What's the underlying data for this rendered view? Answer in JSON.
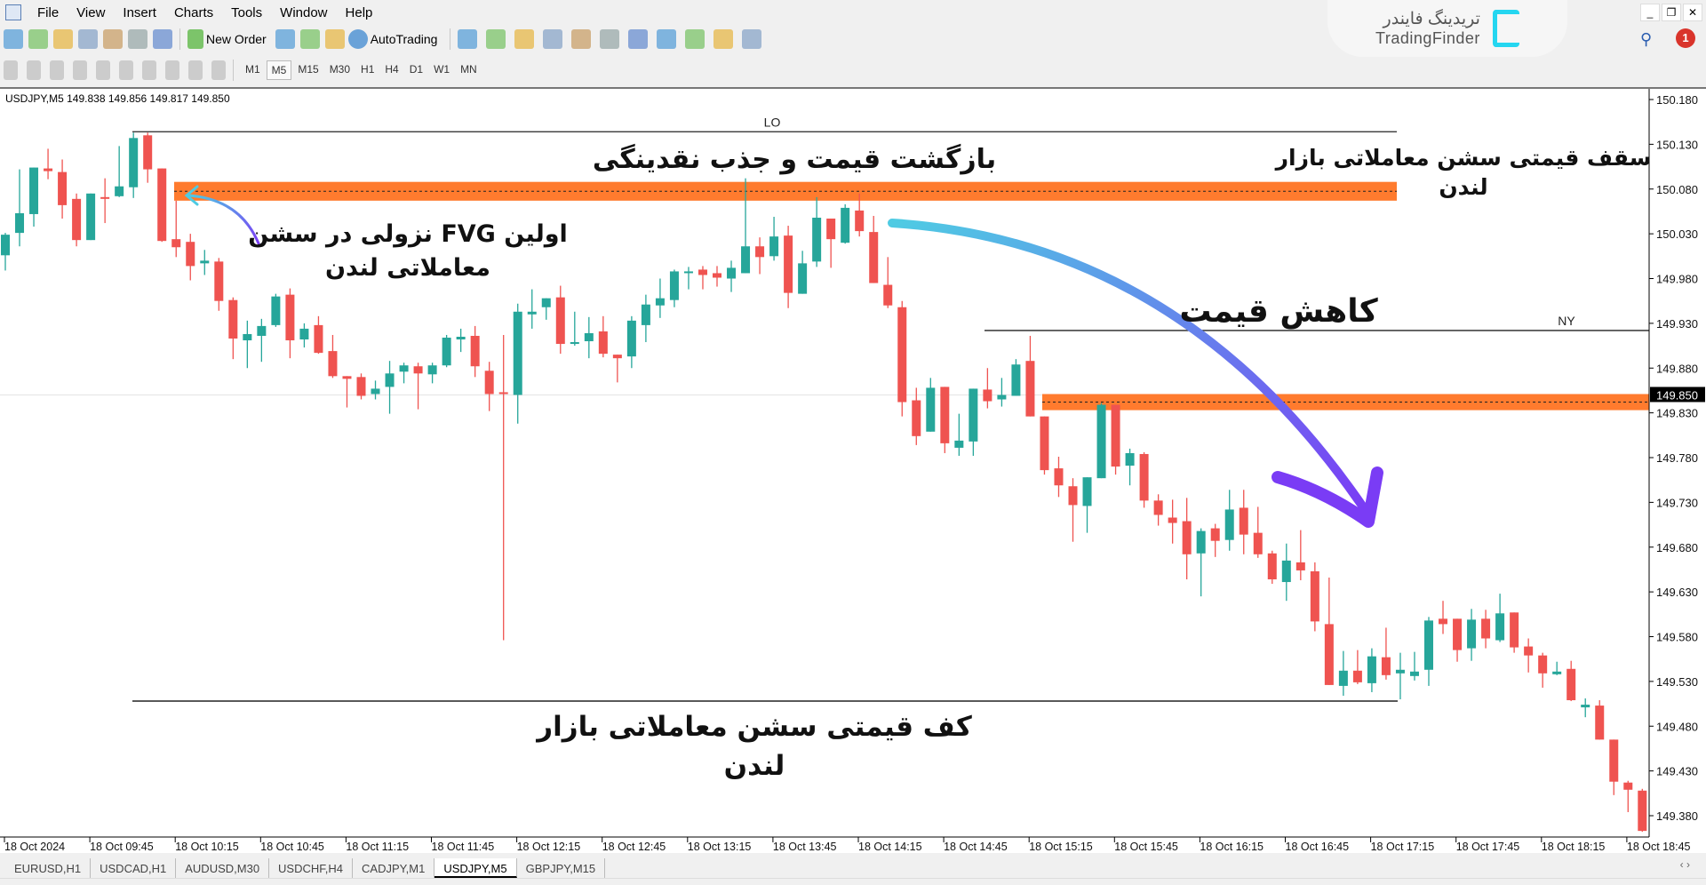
{
  "menu": [
    "File",
    "View",
    "Insert",
    "Charts",
    "Tools",
    "Window",
    "Help"
  ],
  "toolbar1": {
    "icons_before": [
      "new-chart-icon",
      "profiles-icon",
      "market-watch-icon",
      "navigator-icon",
      "data-window-icon",
      "terminal-icon",
      "strategy-tester-icon"
    ],
    "new_order_label": "New Order",
    "icons_middle": [
      "metaeditor-icon",
      "signals-icon",
      "vps-icon"
    ],
    "autotrading_label": "AutoTrading",
    "icons_after": [
      "bar-chart-icon",
      "candlestick-icon",
      "line-chart-icon",
      "zoom-in-icon",
      "zoom-out-icon",
      "tile-windows-icon",
      "chart-shift-icon",
      "autoscroll-icon",
      "indicators-icon",
      "periods-icon",
      "templates-icon"
    ]
  },
  "toolbar2": {
    "tools": [
      "cursor-icon",
      "crosshair-icon",
      "vertical-line-icon",
      "horizontal-line-icon",
      "trendline-icon",
      "equidistant-channel-icon",
      "fibonacci-icon",
      "text-icon",
      "text-label-icon",
      "arrows-icon"
    ],
    "timeframes": [
      "M1",
      "M5",
      "M15",
      "M30",
      "H1",
      "H4",
      "D1",
      "W1",
      "MN"
    ],
    "active_timeframe": "M5"
  },
  "logo": {
    "persian": "تریدینگ فایندر",
    "english": "TradingFinder",
    "color": "#25d6f0"
  },
  "notifications": {
    "count": "1"
  },
  "chart_header": "USDJPY,M5  149.838 149.856 149.817 149.850",
  "tabs": [
    "EURUSD,H1",
    "USDCAD,H1",
    "AUDUSD,M30",
    "USDCHF,H4",
    "CADJPY,M1",
    "USDJPY,M5",
    "GBPJPY,M15"
  ],
  "active_tab": "USDJPY,M5",
  "annotations": {
    "liquidity": "بازگشت قیمت و جذب نقدینگی",
    "london_high_1": "سقف قیمتی سشن معاملاتی بازار",
    "london_high_2": "لندن",
    "first_fvg_1": "اولین FVG نزولی در سشن",
    "first_fvg_2": "معاملاتی لندن",
    "price_drop": "کاهش قیمت",
    "london_low_1": "کف قیمتی سشن معاملاتی بازار",
    "london_low_2": "لندن"
  },
  "chart_data": {
    "type": "candlestick",
    "symbol": "USDJPY",
    "timeframe": "M5",
    "ylim": [
      149.36,
      150.19
    ],
    "y_ticks": [
      "150.180",
      "150.130",
      "150.080",
      "150.030",
      "149.980",
      "149.930",
      "149.880",
      "149.830",
      "149.780",
      "149.730",
      "149.680",
      "149.630",
      "149.580",
      "149.530",
      "149.480",
      "149.430",
      "149.380"
    ],
    "x_ticks": [
      "18 Oct 2024",
      "18 Oct 09:45",
      "18 Oct 10:15",
      "18 Oct 10:45",
      "18 Oct 11:15",
      "18 Oct 11:45",
      "18 Oct 12:15",
      "18 Oct 12:45",
      "18 Oct 13:15",
      "18 Oct 13:45",
      "18 Oct 14:15",
      "18 Oct 14:45",
      "18 Oct 15:15",
      "18 Oct 15:45",
      "18 Oct 16:15",
      "18 Oct 16:45",
      "18 Oct 17:15",
      "18 Oct 17:45",
      "18 Oct 18:15",
      "18 Oct 18:45"
    ],
    "current_price": "149.850",
    "colors": {
      "up": "#26a69a",
      "down": "#ef5350",
      "zone": "#ff7b2e",
      "arrow_start": "#4fcbe3",
      "arrow_end": "#7a3cf5"
    },
    "levels": {
      "LO": {
        "label": "LO",
        "price": 150.144
      },
      "NY": {
        "label": "NY",
        "price": 149.922
      },
      "london_low": {
        "price": 149.508
      }
    },
    "zones": [
      {
        "name": "fvg-london",
        "top": 150.088,
        "bottom": 150.067
      },
      {
        "name": "fvg-ny",
        "top": 149.851,
        "bottom": 149.833
      }
    ],
    "ohlc": [
      [
        150.006,
        150.031,
        149.989,
        150.029
      ],
      [
        150.031,
        150.102,
        150.016,
        150.053
      ],
      [
        150.052,
        150.104,
        150.038,
        150.104
      ],
      [
        150.103,
        150.125,
        150.091,
        150.1
      ],
      [
        150.099,
        150.113,
        150.047,
        150.062
      ],
      [
        150.069,
        150.075,
        150.016,
        150.023
      ],
      [
        150.023,
        150.075,
        150.023,
        150.075
      ],
      [
        150.071,
        150.092,
        150.042,
        150.07
      ],
      [
        150.072,
        150.128,
        150.071,
        150.083
      ],
      [
        150.082,
        150.143,
        150.07,
        150.137
      ],
      [
        150.14,
        150.143,
        150.087,
        150.102
      ],
      [
        150.103,
        150.103,
        150.021,
        150.022
      ],
      [
        150.024,
        150.067,
        150.004,
        150.015
      ],
      [
        150.021,
        150.03,
        149.978,
        149.994
      ],
      [
        149.997,
        150.012,
        149.984,
        150.0
      ],
      [
        149.999,
        150.003,
        149.944,
        149.955
      ],
      [
        149.956,
        149.959,
        149.89,
        149.913
      ],
      [
        149.911,
        149.933,
        149.88,
        149.918
      ],
      [
        149.916,
        149.935,
        149.887,
        149.927
      ],
      [
        149.928,
        149.963,
        149.926,
        149.96
      ],
      [
        149.962,
        149.969,
        149.891,
        149.911
      ],
      [
        149.912,
        149.93,
        149.903,
        149.924
      ],
      [
        149.928,
        149.938,
        149.896,
        149.897
      ],
      [
        149.899,
        149.917,
        149.869,
        149.871
      ],
      [
        149.871,
        149.871,
        149.836,
        149.868
      ],
      [
        149.87,
        149.874,
        149.845,
        149.849
      ],
      [
        149.851,
        149.866,
        149.845,
        149.857
      ],
      [
        149.859,
        149.888,
        149.829,
        149.874
      ],
      [
        149.876,
        149.886,
        149.863,
        149.883
      ],
      [
        149.882,
        149.886,
        149.834,
        149.874
      ],
      [
        149.873,
        149.886,
        149.863,
        149.883
      ],
      [
        149.883,
        149.917,
        149.881,
        149.914
      ],
      [
        149.912,
        149.924,
        149.898,
        149.915
      ],
      [
        149.916,
        149.927,
        149.87,
        149.882
      ],
      [
        149.877,
        149.887,
        149.832,
        149.851
      ],
      [
        149.853,
        149.917,
        149.576,
        149.851
      ],
      [
        149.85,
        149.952,
        149.818,
        149.943
      ],
      [
        149.94,
        149.968,
        149.924,
        149.943
      ],
      [
        149.948,
        149.958,
        149.934,
        149.958
      ],
      [
        149.959,
        149.972,
        149.896,
        149.907
      ],
      [
        149.907,
        149.943,
        149.905,
        149.909
      ],
      [
        149.91,
        149.937,
        149.891,
        149.919
      ],
      [
        149.921,
        149.938,
        149.892,
        149.896
      ],
      [
        149.895,
        149.895,
        149.864,
        149.891
      ],
      [
        149.893,
        149.938,
        149.88,
        149.933
      ],
      [
        149.928,
        149.962,
        149.909,
        149.951
      ],
      [
        149.95,
        149.98,
        149.936,
        149.958
      ],
      [
        149.956,
        149.99,
        149.948,
        149.988
      ],
      [
        149.987,
        149.993,
        149.968,
        149.988
      ],
      [
        149.99,
        149.994,
        149.968,
        149.984
      ],
      [
        149.986,
        149.994,
        149.971,
        149.981
      ],
      [
        149.98,
        150.0,
        149.965,
        149.992
      ],
      [
        149.986,
        150.092,
        149.986,
        150.016
      ],
      [
        150.016,
        150.026,
        149.985,
        150.004
      ],
      [
        150.005,
        150.049,
        150.0,
        150.027
      ],
      [
        150.028,
        150.039,
        149.947,
        149.964
      ],
      [
        149.963,
        150.011,
        149.963,
        149.997
      ],
      [
        149.999,
        150.071,
        149.993,
        150.048
      ],
      [
        150.047,
        150.047,
        149.992,
        150.024
      ],
      [
        150.02,
        150.063,
        150.019,
        150.059
      ],
      [
        150.056,
        150.075,
        150.027,
        150.033
      ],
      [
        150.032,
        150.05,
        149.975,
        149.975
      ],
      [
        149.973,
        150.004,
        149.947,
        149.95
      ],
      [
        149.948,
        149.955,
        149.826,
        149.842
      ],
      [
        149.844,
        149.858,
        149.794,
        149.804
      ],
      [
        149.809,
        149.869,
        149.809,
        149.858
      ],
      [
        149.859,
        149.859,
        149.785,
        149.796
      ],
      [
        149.791,
        149.829,
        149.782,
        149.799
      ],
      [
        149.798,
        149.857,
        149.782,
        149.857
      ],
      [
        149.856,
        149.88,
        149.835,
        149.843
      ],
      [
        149.845,
        149.869,
        149.837,
        149.85
      ],
      [
        149.849,
        149.89,
        149.849,
        149.884
      ],
      [
        149.888,
        149.916,
        149.826,
        149.826
      ],
      [
        149.826,
        149.826,
        149.761,
        149.766
      ],
      [
        149.768,
        149.781,
        149.736,
        149.749
      ],
      [
        149.748,
        149.757,
        149.686,
        149.727
      ],
      [
        149.726,
        149.758,
        149.696,
        149.758
      ],
      [
        149.757,
        149.841,
        149.757,
        149.839
      ],
      [
        149.839,
        149.839,
        149.761,
        149.77
      ],
      [
        149.771,
        149.79,
        149.749,
        149.785
      ],
      [
        149.784,
        149.786,
        149.724,
        149.732
      ],
      [
        149.732,
        149.739,
        149.704,
        149.716
      ],
      [
        149.713,
        149.733,
        149.684,
        149.707
      ],
      [
        149.709,
        149.735,
        149.644,
        149.672
      ],
      [
        149.673,
        149.701,
        149.625,
        149.698
      ],
      [
        149.701,
        149.706,
        149.669,
        149.687
      ],
      [
        149.688,
        149.744,
        149.676,
        149.722
      ],
      [
        149.724,
        149.744,
        149.672,
        149.694
      ],
      [
        149.696,
        149.725,
        149.668,
        149.672
      ],
      [
        149.673,
        149.676,
        149.639,
        149.644
      ],
      [
        149.641,
        149.684,
        149.62,
        149.665
      ],
      [
        149.663,
        149.699,
        149.643,
        149.654
      ],
      [
        149.653,
        149.663,
        149.586,
        149.597
      ],
      [
        149.594,
        149.646,
        149.526,
        149.526
      ],
      [
        149.525,
        149.564,
        149.514,
        149.542
      ],
      [
        149.542,
        149.565,
        149.527,
        149.529
      ],
      [
        149.528,
        149.567,
        149.518,
        149.558
      ],
      [
        149.557,
        149.59,
        149.532,
        149.537
      ],
      [
        149.539,
        149.562,
        149.51,
        149.543
      ],
      [
        149.536,
        149.563,
        149.531,
        149.541
      ],
      [
        149.543,
        149.602,
        149.525,
        149.598
      ],
      [
        149.6,
        149.62,
        149.583,
        149.594
      ],
      [
        149.6,
        149.6,
        149.552,
        149.565
      ],
      [
        149.567,
        149.611,
        149.553,
        149.599
      ],
      [
        149.6,
        149.61,
        149.567,
        149.578
      ],
      [
        149.576,
        149.628,
        149.574,
        149.606
      ],
      [
        149.607,
        149.607,
        149.562,
        149.568
      ],
      [
        149.569,
        149.578,
        149.54,
        149.559
      ],
      [
        149.559,
        149.562,
        149.523,
        149.539
      ],
      [
        149.538,
        149.552,
        149.537,
        149.541
      ],
      [
        149.544,
        149.553,
        149.508,
        149.509
      ],
      [
        149.501,
        149.511,
        149.49,
        149.504
      ],
      [
        149.503,
        149.509,
        149.465,
        149.465
      ],
      [
        149.465,
        149.465,
        149.403,
        149.418
      ],
      [
        149.417,
        149.419,
        149.384,
        149.409
      ],
      [
        149.408,
        149.41,
        149.362,
        149.363
      ]
    ]
  }
}
